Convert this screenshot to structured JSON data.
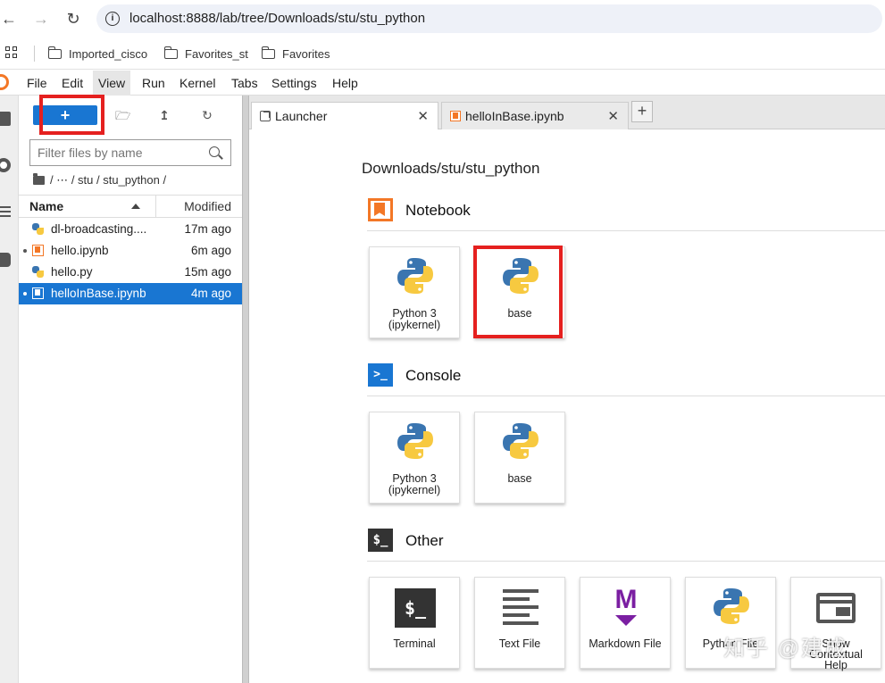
{
  "browser": {
    "url": "localhost:8888/lab/tree/Downloads/stu/stu_python",
    "bookmarks": [
      "Imported_cisco",
      "Favorites_st",
      "Favorites"
    ]
  },
  "menu": [
    "File",
    "Edit",
    "View",
    "Run",
    "Kernel",
    "Tabs",
    "Settings",
    "Help"
  ],
  "filebrowser": {
    "new_label": "+",
    "filter_placeholder": "Filter files by name",
    "breadcrumb": "/   ⋯  / stu / stu_python /",
    "col_name": "Name",
    "col_modified": "Modified",
    "files": [
      {
        "name": "dl-broadcasting....",
        "modified": "17m ago",
        "type": "python"
      },
      {
        "name": "hello.ipynb",
        "modified": "6m ago",
        "type": "notebook"
      },
      {
        "name": "hello.py",
        "modified": "15m ago",
        "type": "python"
      },
      {
        "name": "helloInBase.ipynb",
        "modified": "4m ago",
        "type": "notebook",
        "selected": true
      }
    ]
  },
  "tabs": [
    {
      "label": "Launcher",
      "active": true
    },
    {
      "label": "helloInBase.ipynb",
      "active": false
    }
  ],
  "launcher": {
    "cwd": "Downloads/stu/stu_python",
    "sections": {
      "notebook": {
        "title": "Notebook",
        "cards": [
          {
            "line1": "Python 3",
            "line2": "(ipykernel)"
          },
          {
            "line1": "base",
            "line2": ""
          }
        ]
      },
      "console": {
        "title": "Console",
        "icon_text": ">_",
        "cards": [
          {
            "line1": "Python 3",
            "line2": "(ipykernel)"
          },
          {
            "line1": "base",
            "line2": ""
          }
        ]
      },
      "other": {
        "title": "Other",
        "icon_text": "$_",
        "cards": [
          {
            "line1": "Terminal",
            "line2": ""
          },
          {
            "line1": "Text File",
            "line2": ""
          },
          {
            "line1": "Markdown File",
            "line2": ""
          },
          {
            "line1": "Python File",
            "line2": ""
          },
          {
            "line1": "Show",
            "line2": "Contextual",
            "line3": "Help"
          }
        ]
      }
    }
  },
  "terminal_glyph": "$_",
  "markdown_glyph": "M",
  "watermark": "知乎 @建成",
  "colors": {
    "accent": "#1976d2",
    "jupyter_orange": "#f37726",
    "highlight": "#e5201f"
  }
}
